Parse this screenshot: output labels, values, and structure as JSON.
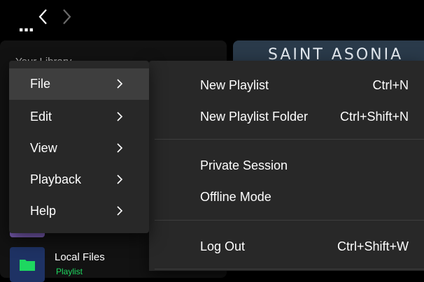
{
  "topbar": {
    "more_label": "...",
    "back_icon": "chevron-left-icon",
    "forward_icon": "chevron-right-icon"
  },
  "library": {
    "header_label": "Your Library",
    "local_files": {
      "title": "Local Files",
      "subtitle": "Playlist"
    }
  },
  "banner": {
    "text": "SAINT ASONIA"
  },
  "main_menu": {
    "items": [
      {
        "label": "File",
        "active": true
      },
      {
        "label": "Edit",
        "active": false
      },
      {
        "label": "View",
        "active": false
      },
      {
        "label": "Playback",
        "active": false
      },
      {
        "label": "Help",
        "active": false
      }
    ]
  },
  "file_menu": {
    "items": [
      {
        "label": "New Playlist",
        "shortcut": "Ctrl+N"
      },
      {
        "label": "New Playlist Folder",
        "shortcut": "Ctrl+Shift+N"
      },
      {
        "label": "Private Session",
        "shortcut": ""
      },
      {
        "label": "Offline Mode",
        "shortcut": ""
      },
      {
        "label": "Log Out",
        "shortcut": "Ctrl+Shift+W"
      }
    ]
  },
  "colors": {
    "menu_bg": "#282828",
    "active_bg": "#3e3e3e",
    "accent": "#1ed760"
  }
}
